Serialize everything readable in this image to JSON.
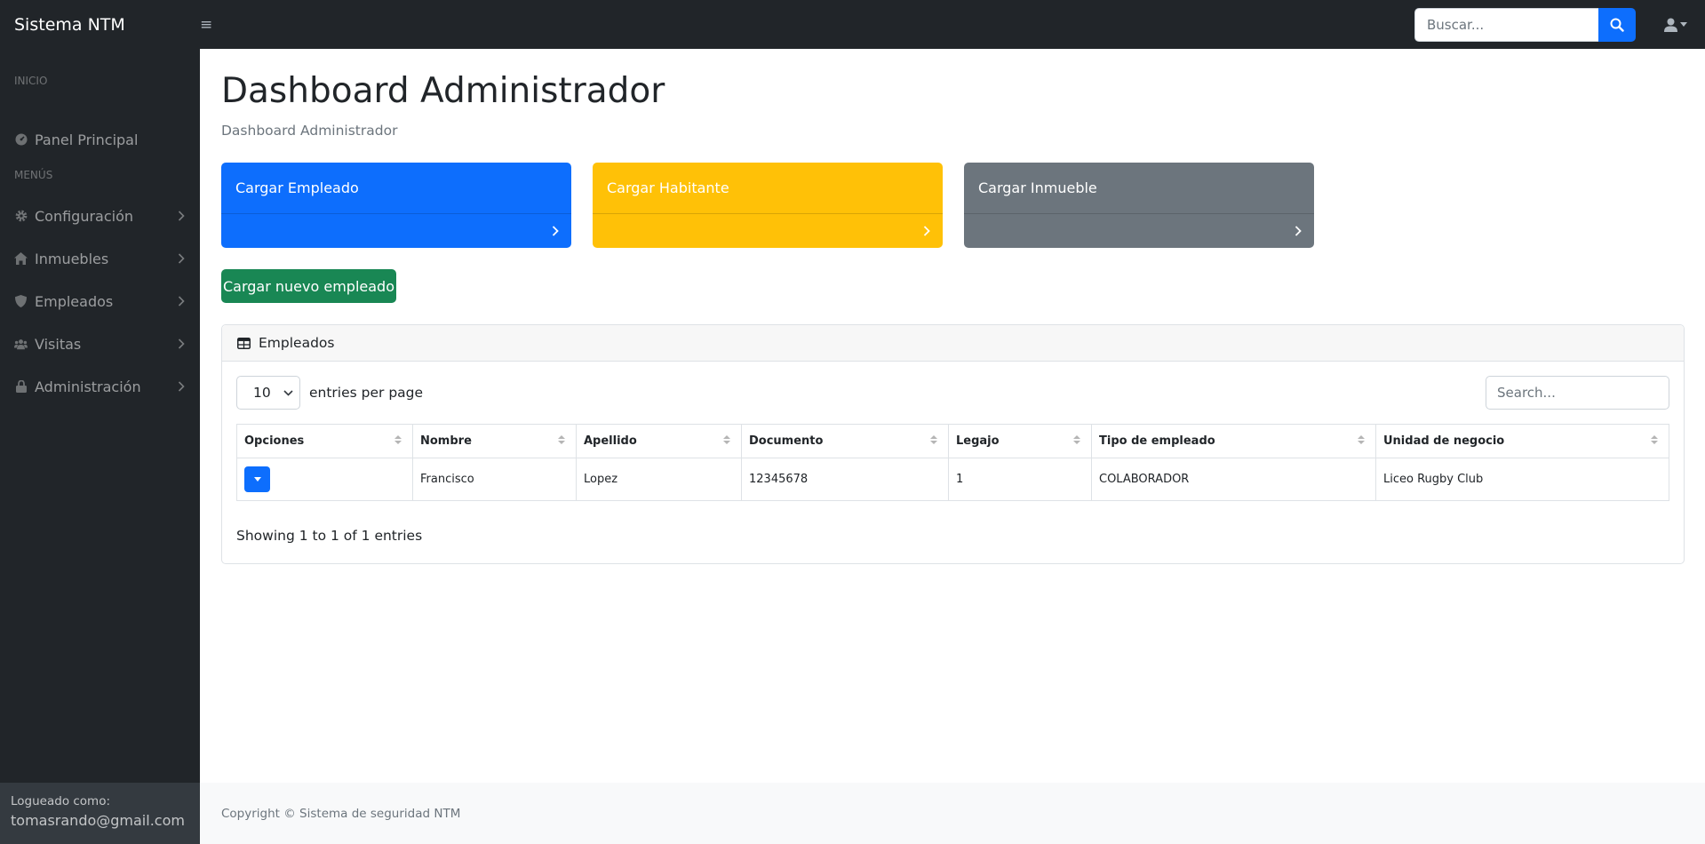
{
  "navbar": {
    "brand": "Sistema NTM",
    "toggle_glyph": "≡",
    "search_placeholder": "Buscar...",
    "search_icon": "search-icon",
    "user_icon": "user-icon"
  },
  "sidebar": {
    "heading_inicio": "INICIO",
    "panel_principal": "Panel Principal",
    "heading_menus": "MENÚS",
    "items": [
      {
        "label": "Configuración",
        "icon": "gear-icon"
      },
      {
        "label": "Inmuebles",
        "icon": "home-icon"
      },
      {
        "label": "Empleados",
        "icon": "shield-icon"
      },
      {
        "label": "Visitas",
        "icon": "users-icon"
      },
      {
        "label": "Administración",
        "icon": "lock-icon"
      }
    ],
    "footer_label": "Logueado como:",
    "footer_email": "tomasrando@gmail.com"
  },
  "main": {
    "title": "Dashboard Administrador",
    "breadcrumb": "Dashboard Administrador",
    "tiles": [
      {
        "label": "Cargar Empleado",
        "color": "#0d6efd"
      },
      {
        "label": "Cargar Habitante",
        "color": "#ffc107"
      },
      {
        "label": "Cargar Inmueble",
        "color": "#6c757d"
      }
    ],
    "new_button": "Cargar nuevo empleado",
    "table_card": {
      "title": "Empleados",
      "per_page_value": "10",
      "per_page_label": "entries per page",
      "search_placeholder": "Search...",
      "columns": [
        "Opciones",
        "Nombre",
        "Apellido",
        "Documento",
        "Legajo",
        "Tipo de empleado",
        "Unidad de negocio"
      ],
      "rows": [
        {
          "nombre": "Francisco",
          "apellido": "Lopez",
          "documento": "12345678",
          "legajo": "1",
          "tipo": "COLABORADOR",
          "unidad": "Liceo Rugby Club"
        }
      ],
      "info": "Showing 1 to 1 of 1 entries"
    }
  },
  "footer": {
    "text": "Copyright © Sistema de seguridad NTM"
  },
  "colors": {
    "dark": "#212529",
    "primary": "#0d6efd",
    "warning": "#ffc107",
    "secondary": "#6c757d",
    "success": "#198754"
  }
}
